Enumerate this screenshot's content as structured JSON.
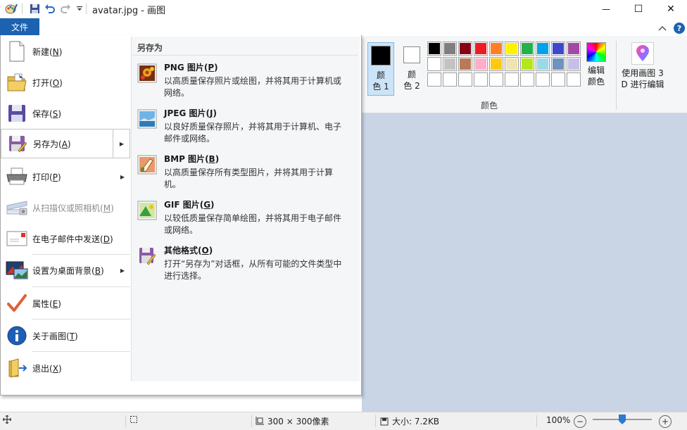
{
  "window": {
    "title": "avatar.jpg - 画图",
    "minimize_glyph": "—",
    "maximize_glyph": "☐",
    "close_glyph": "✕"
  },
  "ribbon": {
    "file_tab_label": "文件",
    "collapse_glyph": "^",
    "help_glyph": "?",
    "color1_label_line1": "颜",
    "color1_label_line2": "色 1",
    "color2_label_line1": "颜",
    "color2_label_line2": "色 2",
    "color1_value": "#000000",
    "color2_value": "#ffffff",
    "palette_row1": [
      "#000000",
      "#7f7f7f",
      "#880015",
      "#ed1c24",
      "#ff7f27",
      "#fff200",
      "#22b14c",
      "#00a2e8",
      "#3f48cc",
      "#a349a4"
    ],
    "palette_row2": [
      "#ffffff",
      "#c3c3c3",
      "#b97a57",
      "#ffaec9",
      "#ffc90e",
      "#efe4b0",
      "#b5e61d",
      "#99d9ea",
      "#7092be",
      "#c8bfe7"
    ],
    "edit_colors_line1": "编辑",
    "edit_colors_line2": "颜色",
    "group_label": "颜色",
    "paint3d_line1": "使用画图 3",
    "paint3d_line2": "D 进行编辑"
  },
  "file_menu": {
    "items": [
      {
        "label": "新建",
        "key": "N",
        "icon": "new-document-icon"
      },
      {
        "label": "打开",
        "key": "O",
        "icon": "open-folder-icon"
      },
      {
        "label": "保存",
        "key": "S",
        "icon": "save-disk-icon"
      },
      {
        "label": "另存为",
        "key": "A",
        "icon": "save-as-icon",
        "submenu": true,
        "active": true
      },
      {
        "label": "打印",
        "key": "P",
        "icon": "printer-icon",
        "submenu": true
      },
      {
        "label": "从扫描仪或照相机",
        "key": "M",
        "icon": "scanner-icon",
        "disabled": true
      },
      {
        "label": "在电子邮件中发送",
        "key": "D",
        "icon": "email-icon"
      },
      {
        "label": "设置为桌面背景",
        "key": "B",
        "icon": "desktop-background-icon",
        "submenu": true
      },
      {
        "label": "属性",
        "key": "E",
        "icon": "checkmark-icon"
      },
      {
        "label": "关于画图",
        "key": "T",
        "icon": "info-icon"
      },
      {
        "label": "退出",
        "key": "X",
        "icon": "exit-icon"
      }
    ],
    "submenu_arrow": "▶"
  },
  "save_as_panel": {
    "title": "另存为",
    "options": [
      {
        "head": "PNG 图片",
        "key": "P",
        "desc": "以高质量保存照片或绘图，并将其用于计算机或网络。",
        "icon": "png-image-icon"
      },
      {
        "head": "JPEG 图片",
        "key": "J",
        "desc": "以良好质量保存照片，并将其用于计算机、电子邮件或网络。",
        "icon": "jpeg-image-icon"
      },
      {
        "head": "BMP 图片",
        "key": "B",
        "desc": "以高质量保存所有类型图片，并将其用于计算机。",
        "icon": "bmp-image-icon"
      },
      {
        "head": "GIF 图片",
        "key": "G",
        "desc": "以较低质量保存简单绘图，并将其用于电子邮件或网络。",
        "icon": "gif-image-icon"
      },
      {
        "head": "其他格式",
        "key": "O",
        "desc": "打开“另存为”对话框，从所有可能的文件类型中进行选择。",
        "icon": "other-formats-icon"
      }
    ]
  },
  "statusbar": {
    "dimensions": "300 × 300像素",
    "size": "大小: 7.2KB",
    "zoom": "100%",
    "zoom_out_glyph": "−",
    "zoom_in_glyph": "+",
    "zoom_fraction": 0.5
  }
}
